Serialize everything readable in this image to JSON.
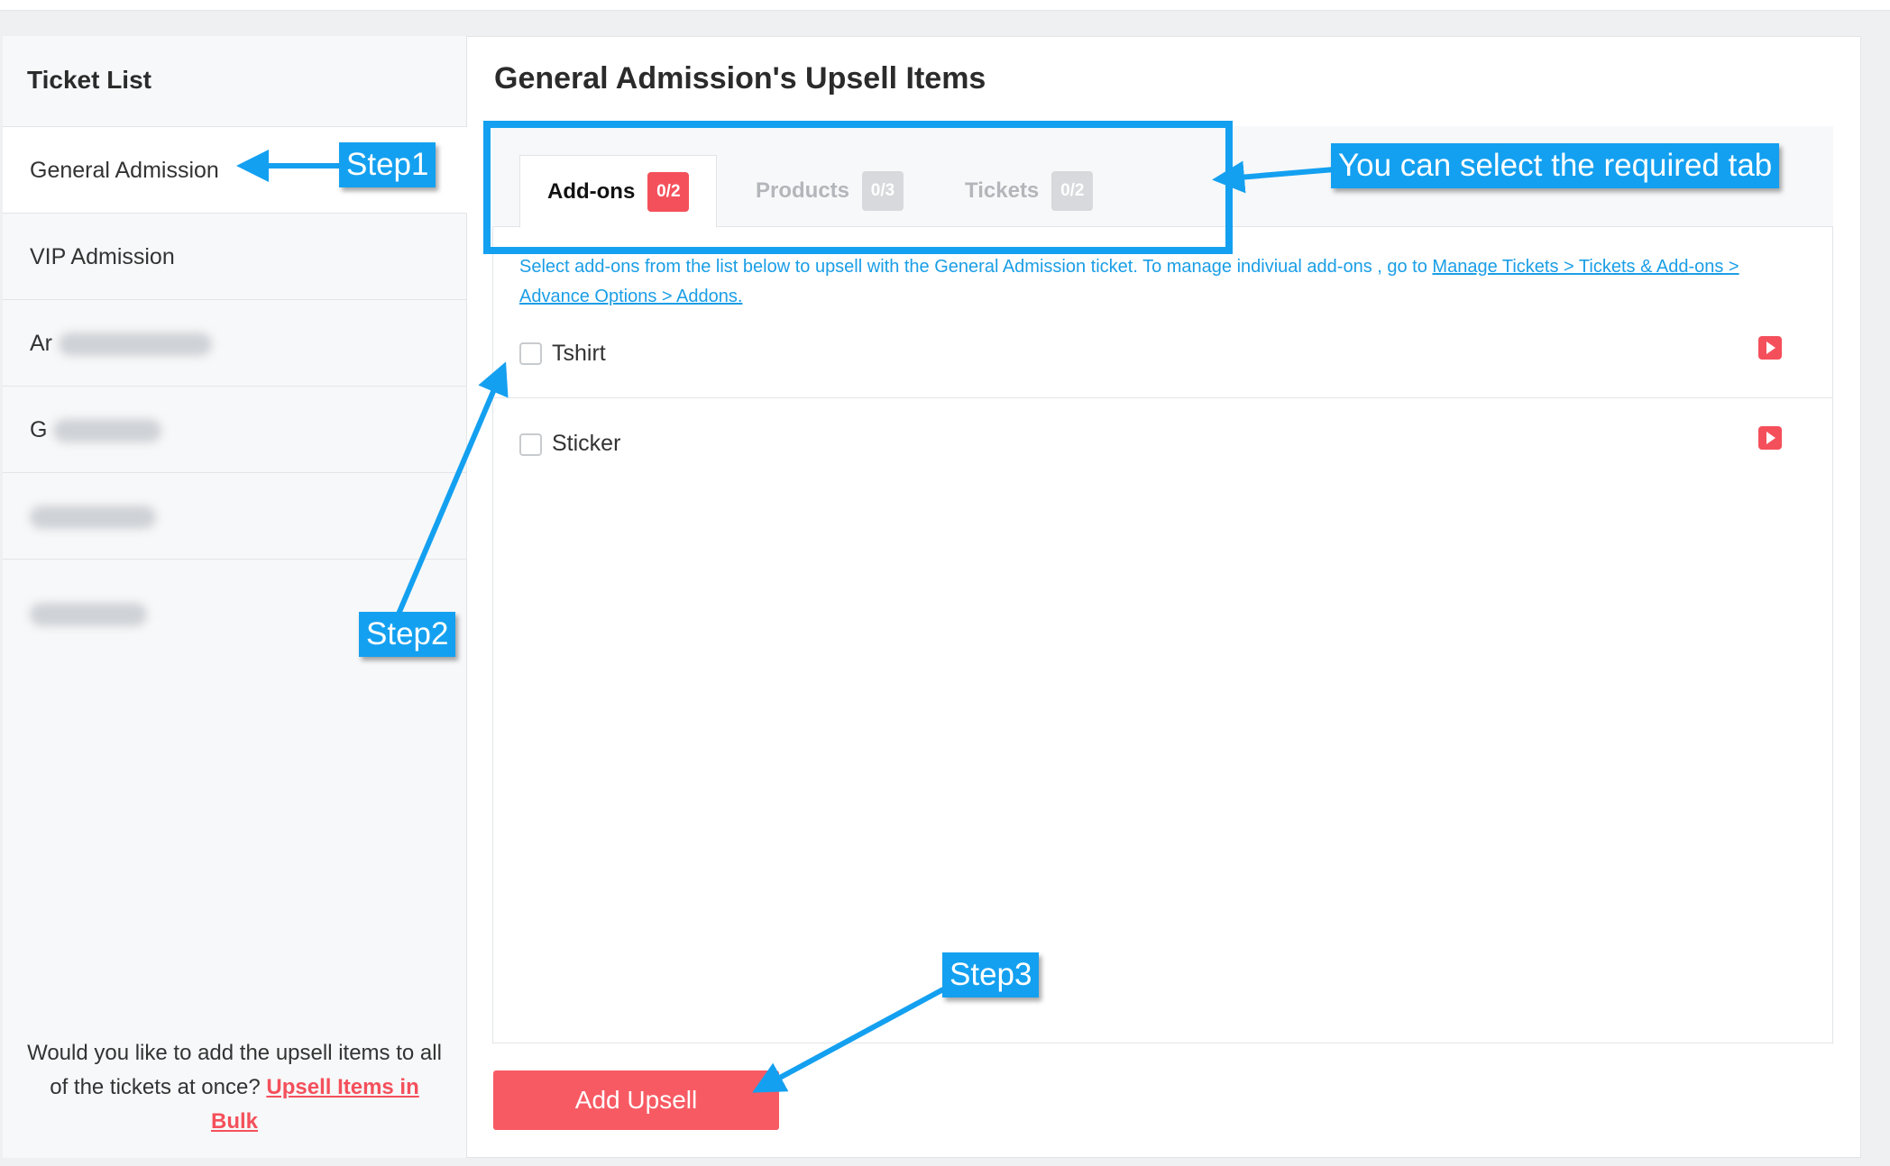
{
  "sidebar": {
    "title": "Ticket List",
    "items": [
      {
        "label": "General Admission",
        "active": true
      },
      {
        "label": "VIP Admission",
        "active": false
      },
      {
        "label": "Ar",
        "active": false
      },
      {
        "label": "G",
        "active": false
      },
      {
        "label": "",
        "active": false
      },
      {
        "label": "",
        "active": false
      }
    ],
    "footer_text": "Would you like to add the upsell items to all of the tickets at once?",
    "footer_link": "Upsell Items in Bulk"
  },
  "main": {
    "title": "General Admission's Upsell Items",
    "tabs": [
      {
        "label": "Add-ons",
        "badge": "0/2",
        "active": true
      },
      {
        "label": "Products",
        "badge": "0/3",
        "active": false
      },
      {
        "label": "Tickets",
        "badge": "0/2",
        "active": false
      }
    ],
    "description_text": "Select add-ons from the list below to upsell with the General Admission ticket. To manage indiviual add-ons , go to",
    "description_link": "Manage Tickets > Tickets & Add-ons > Advance Options > Addons.",
    "items": [
      {
        "label": "Tshirt",
        "checked": false
      },
      {
        "label": "Sticker",
        "checked": false
      }
    ],
    "add_button": "Add Upsell"
  },
  "annotations": {
    "step1": "Step1",
    "step2": "Step2",
    "step3": "Step3",
    "tab_hint": "You can select the required tab"
  },
  "colors": {
    "accent": "#f85a63",
    "link": "#1a9ee6",
    "annotation": "#14a0f0",
    "badge_inactive": "#d7d9dc"
  },
  "icons": {
    "item_action": "play-icon"
  }
}
